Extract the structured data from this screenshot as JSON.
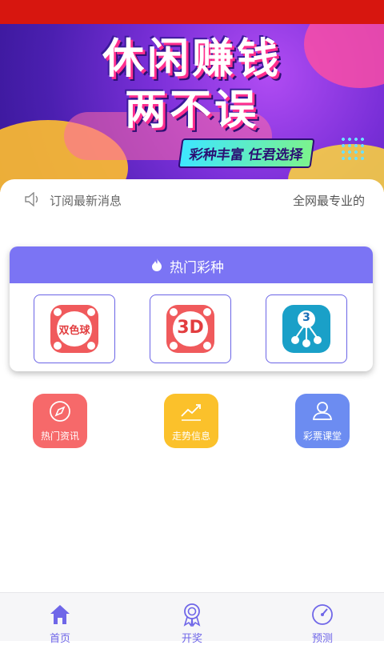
{
  "banner": {
    "title_line1": "休闲赚钱",
    "title_line2": "两不误",
    "tagline": "彩种丰富 任君选择"
  },
  "notice": {
    "icon": "speaker-icon",
    "message_left": "订阅最新消息",
    "message_right": "全网最专业的"
  },
  "hot_lottery": {
    "header_icon": "flame-icon",
    "title": "热门彩种",
    "items": [
      {
        "name": "double-color-ball",
        "icon_text": "双色球",
        "color": "#f05a5c"
      },
      {
        "name": "3d",
        "icon_text": "3D",
        "color": "#f05a5c"
      },
      {
        "name": "pick-3",
        "icon_text": "3",
        "color": "#1aa0c8"
      }
    ]
  },
  "shortcuts": [
    {
      "label": "热门资讯",
      "icon": "compass-icon",
      "color": "#f6696a"
    },
    {
      "label": "走势信息",
      "icon": "trend-chart-icon",
      "color": "#fbc12b"
    },
    {
      "label": "彩票课堂",
      "icon": "user-icon",
      "color": "#6c8cf1"
    }
  ],
  "tabbar": {
    "active_color": "#6f66e8",
    "tabs": [
      {
        "label": "首页",
        "icon": "home-icon"
      },
      {
        "label": "开奖",
        "icon": "medal-icon"
      },
      {
        "label": "预测",
        "icon": "gauge-icon"
      }
    ]
  }
}
